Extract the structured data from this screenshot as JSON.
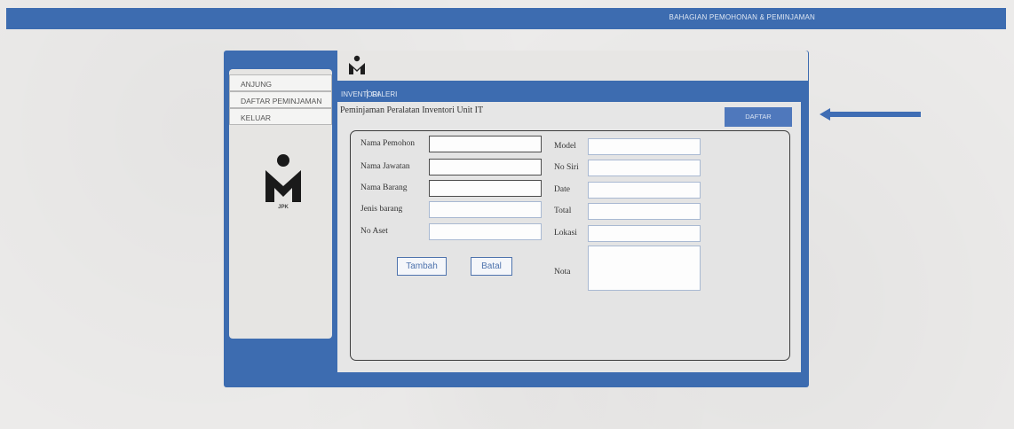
{
  "header": {
    "title": "BAHAGIAN PEMOHONAN & PEMINJAMAN"
  },
  "sidebar": {
    "items": [
      {
        "label": "ANJUNG"
      },
      {
        "label": "DAFTAR PEMINJAMAN"
      },
      {
        "label": "KELUAR"
      }
    ],
    "logo_text": "JPK"
  },
  "tabs": [
    {
      "label": "INVENTORI"
    },
    {
      "label": "GALERI"
    }
  ],
  "form": {
    "title": "Peminjaman Peralatan Inventori Unit IT",
    "daftar_label": "DAFTAR",
    "left_fields": [
      {
        "label": "Nama Pemohon",
        "value": ""
      },
      {
        "label": "Nama Jawatan",
        "value": ""
      },
      {
        "label": "Nama Barang",
        "value": ""
      },
      {
        "label": "Jenis barang",
        "value": ""
      },
      {
        "label": "No Aset",
        "value": ""
      }
    ],
    "right_fields": [
      {
        "label": "Model",
        "value": ""
      },
      {
        "label": "No Siri",
        "value": ""
      },
      {
        "label": "Date",
        "value": ""
      },
      {
        "label": "Total",
        "value": ""
      },
      {
        "label": "Lokasi",
        "value": ""
      },
      {
        "label": "Nota",
        "value": ""
      }
    ],
    "tambah_label": "Tambah",
    "batal_label": "Batal"
  },
  "colors": {
    "frame_blue": "#3d6cb0",
    "button_blue": "#4f78bc",
    "arrow_blue": "#3f6db4"
  }
}
